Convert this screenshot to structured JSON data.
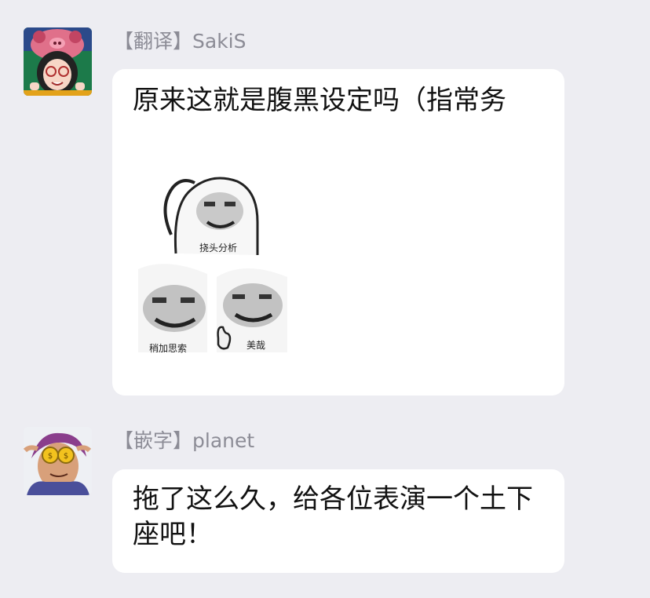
{
  "messages": [
    {
      "sender": "【翻译】SakiS",
      "text": "原来这就是腹黑设定吗（指常务",
      "sticker": {
        "captions": [
          "挠头分析",
          "稍加思索",
          "美哉"
        ]
      }
    },
    {
      "sender": "【嵌字】planet",
      "text": "拖了这么久，给各位表演一个土下座吧！"
    }
  ],
  "colors": {
    "background": "#ededf2",
    "bubble": "#ffffff",
    "sender_text": "#8c8c96",
    "message_text": "#111111"
  }
}
